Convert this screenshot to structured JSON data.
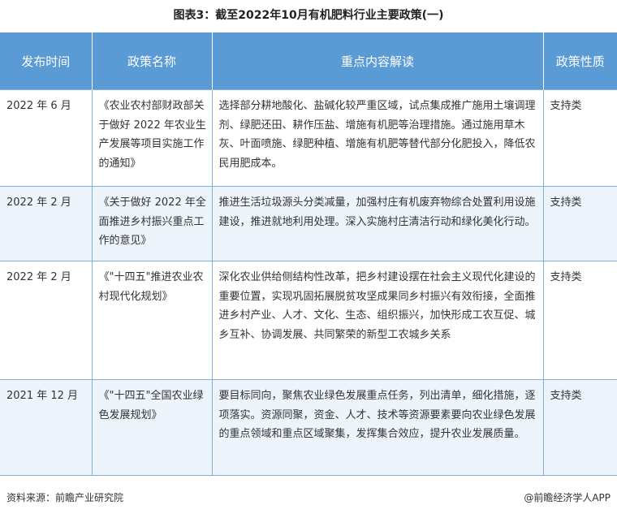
{
  "title": "图表3：截至2022年10月有机肥料行业主要政策(一)",
  "table": {
    "headers": [
      "发布时间",
      "政策名称",
      "重点内容解读",
      "政策性质"
    ],
    "rows": [
      {
        "date": "2022 年 6 月",
        "name": "《农业农村部财政部关于做好 2022 年农业生产发展等项目实施工作的通知》",
        "content": "选择部分耕地酸化、盐碱化较严重区域，试点集成推广施用土壤调理剂、绿肥还田、耕作压盐、增施有机肥等治理措施。通过施用草木灰、叶面喷施、绿肥种植、增施有机肥等替代部分化肥投入，降低农民用肥成本。",
        "nature": "支持类"
      },
      {
        "date": "2022 年 2 月",
        "name": "《关于做好 2022 年全面推进乡村振兴重点工作的意见》",
        "content": "推进生活垃圾源头分类减量，加强村庄有机废弃物综合处置利用设施建设，推进就地利用处理。深入实施村庄清洁行动和绿化美化行动。",
        "nature": "支持类"
      },
      {
        "date": "2022 年 2 月",
        "name": "《\"十四五\"推进农业农村现代化规划》",
        "content": "深化农业供给侧结构性改革，把乡村建设摆在社会主义现代化建设的重要位置，实现巩固拓展脱贫攻坚成果同乡村振兴有效衔接，全面推进乡村产业、人才、文化、生态、组织振兴，加快形成工农互促、城乡互补、协调发展、共同繁荣的新型工农城乡关系",
        "nature": "支持类"
      },
      {
        "date": "2021 年 12 月",
        "name": "《\"十四五\"全国农业绿色发展规划》",
        "content": "要目标同向，聚焦农业绿色发展重点任务，列出清单，细化措施，逐项落实。资源同聚，资金、人才、技术等资源要素要向农业绿色发展的重点领域和重点区域聚集，发挥集合效应，提升农业发展质量。",
        "nature": "支持类"
      }
    ]
  },
  "footer": {
    "source": "资料来源：前瞻产业研究院",
    "brand": "@前瞻经济学人APP"
  }
}
